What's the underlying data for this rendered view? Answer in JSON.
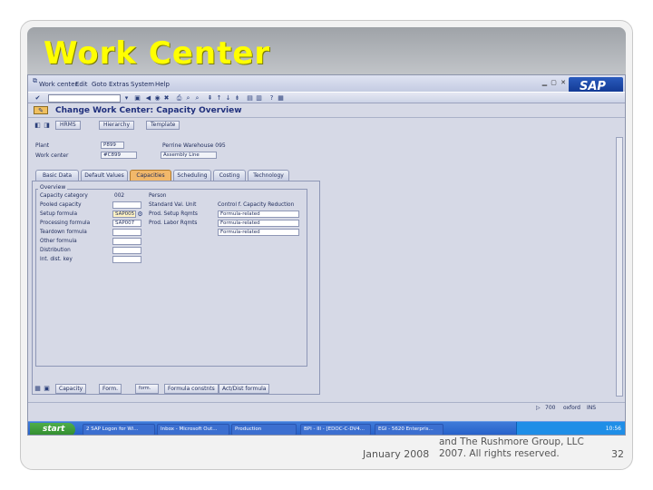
{
  "slide": {
    "title": "Work Center",
    "footer_date": "January 2008",
    "footer_copy_line1": "and The Rushmore Group, LLC",
    "footer_copy_line2": "2007. All rights reserved.",
    "page_number": "32"
  },
  "sap": {
    "menu": [
      "Work center",
      "Edit",
      "Goto",
      "Extras",
      "System",
      "Help"
    ],
    "title": "Change Work Center: Capacity Overview",
    "app_buttons": [
      "HRMS",
      "Hierarchy",
      "Template"
    ],
    "header": {
      "plant_label": "Plant",
      "plant_value": "P899",
      "plant_desc": "Perrine Warehouse 095",
      "wc_label": "Work center",
      "wc_value": "#C899",
      "wc_desc": "Assembly Line"
    },
    "tabs": [
      "Basic Data",
      "Default Values",
      "Capacities",
      "Scheduling",
      "Costing",
      "Technology"
    ],
    "active_tab": "Capacities",
    "overview": {
      "group_title": "Overview",
      "col_category": "Capacity category",
      "col_category_value": "002",
      "col_person": "Person",
      "col_std": "Standard Val. Unit",
      "col_control": "Control f. Capacity Reduction",
      "rows": [
        {
          "label": "Pooled capacity",
          "formula": "",
          "desc": "",
          "control": ""
        },
        {
          "label": "Setup formula",
          "formula": "SAP005",
          "desc": "Prod. Setup Rqmts",
          "control": "Formula-related"
        },
        {
          "label": "Processing formula",
          "formula": "SAP007",
          "desc": "Prod. Labor Rqmts",
          "control": "Formula-related"
        },
        {
          "label": "Teardown formula",
          "formula": "",
          "desc": "",
          "control": "Formula-related"
        },
        {
          "label": "Other formula",
          "formula": "",
          "desc": "",
          "control": ""
        },
        {
          "label": "Distribution",
          "formula": "",
          "desc": "",
          "control": ""
        },
        {
          "label": "Int. dist. key",
          "formula": "",
          "desc": "",
          "control": ""
        }
      ]
    },
    "bottom_buttons": [
      "Capacity",
      "Form.",
      "Formula constnts",
      "Act/Dist formula"
    ],
    "status_text": "700",
    "status_server": "oxford",
    "status_mode": "INS",
    "taskbar": {
      "start": "start",
      "tasks": [
        "2 SAP Logon for Wi...",
        "Inbox - Microsoft Out...",
        "Production",
        "BPI - III - [EDOC-C-DV4...",
        "EGI - 5620 Enterpris..."
      ],
      "clock": "10:56"
    }
  }
}
